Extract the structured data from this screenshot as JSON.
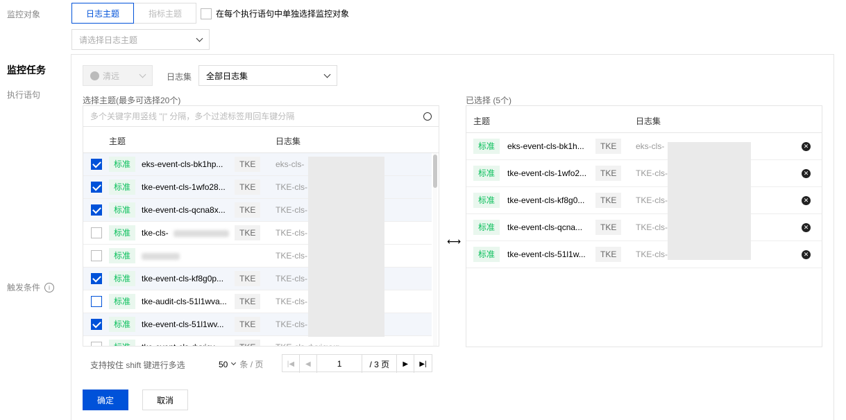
{
  "monitor_target": {
    "label": "监控对象",
    "seg_log": "日志主题",
    "seg_metric": "指标主题",
    "per_statement_checkbox": "在每个执行语句中单独选择监控对象",
    "select_placeholder": "请选择日志主题"
  },
  "monitor_task": {
    "title": "监控任务",
    "exec_label": "执行语句",
    "trigger_label": "触发条件"
  },
  "filter": {
    "region_label": "清远",
    "logset_label": "日志集",
    "logset_value": "全部日志集"
  },
  "left_panel": {
    "title": "选择主题(最多可选择20个)",
    "search_placeholder": "多个关键字用竖线 \"|\" 分隔，多个过滤标签用回车键分隔",
    "col_topic": "主题",
    "col_logset": "日志集",
    "rows": [
      {
        "checked": true,
        "tag": "标准",
        "topic": "eks-event-cls-bk1hp...",
        "type": "TKE",
        "logset": "eks-cls-"
      },
      {
        "checked": true,
        "tag": "标准",
        "topic": "tke-event-cls-1wfo28...",
        "type": "TKE",
        "logset": "TKE-cls-"
      },
      {
        "checked": true,
        "tag": "标准",
        "topic": "tke-event-cls-qcna8x...",
        "type": "TKE",
        "logset": "TKE-cls-"
      },
      {
        "checked": false,
        "tag": "标准",
        "topic": "tke-cls-",
        "type": "TKE",
        "logset": "TKE-cls-"
      },
      {
        "checked": false,
        "tag": "标准",
        "topic": "",
        "type": "",
        "logset": "TKE-cls-"
      },
      {
        "checked": true,
        "tag": "标准",
        "topic": "tke-event-cls-kf8g0p...",
        "type": "TKE",
        "logset": "TKE-cls-"
      },
      {
        "checked": false,
        "tag": "标准",
        "topic": "tke-audit-cls-51l1wva...",
        "type": "TKE",
        "logset": "TKE-cls-"
      },
      {
        "checked": true,
        "tag": "标准",
        "topic": "tke-event-cls-51l1wv...",
        "type": "TKE",
        "logset": "TKE-cls-"
      },
      {
        "checked": false,
        "tag": "标准",
        "topic": "tke-event-cls-dyxjcv...",
        "type": "TKE",
        "logset": "TKE-cls-dyxjcvyq"
      }
    ]
  },
  "right_panel": {
    "title": "已选择 (5个)",
    "col_topic": "主题",
    "col_logset": "日志集",
    "rows": [
      {
        "tag": "标准",
        "topic": "eks-event-cls-bk1h...",
        "type": "TKE",
        "logset": "eks-cls-"
      },
      {
        "tag": "标准",
        "topic": "tke-event-cls-1wfo2...",
        "type": "TKE",
        "logset": "TKE-cls-"
      },
      {
        "tag": "标准",
        "topic": "tke-event-cls-kf8g0...",
        "type": "TKE",
        "logset": "TKE-cls-"
      },
      {
        "tag": "标准",
        "topic": "tke-event-cls-qcna...",
        "type": "TKE",
        "logset": "TKE-cls-"
      },
      {
        "tag": "标准",
        "topic": "tke-event-cls-51l1w...",
        "type": "TKE",
        "logset": "TKE-cls-"
      }
    ]
  },
  "transfer_icon": "⟷",
  "pagination": {
    "hint": "支持按住 shift 键进行多选",
    "page_size": "50",
    "page_size_unit": "条 / 页",
    "current_page": "1",
    "total_pages": "/ 3 页"
  },
  "actions": {
    "confirm": "确定",
    "cancel": "取消"
  }
}
